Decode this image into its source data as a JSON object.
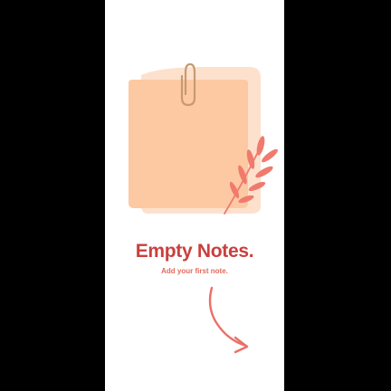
{
  "empty_state": {
    "title": "Empty Notes.",
    "subtitle": "Add your first note."
  },
  "illustration": {
    "icons": [
      "sticky-note-icon",
      "paperclip-icon",
      "leaf-icon"
    ]
  },
  "arrow": {
    "icon": "curved-arrow-icon"
  },
  "colors": {
    "frame": "#000000",
    "screen": "#ffffff",
    "note_back": "#fde1cd",
    "note_front": "#fdc9a2",
    "paperclip": "#c89a70",
    "leaf": "#f07a6e",
    "title": "#c9403e",
    "subtitle": "#e36a5b",
    "arrow": "#ea6f67"
  }
}
